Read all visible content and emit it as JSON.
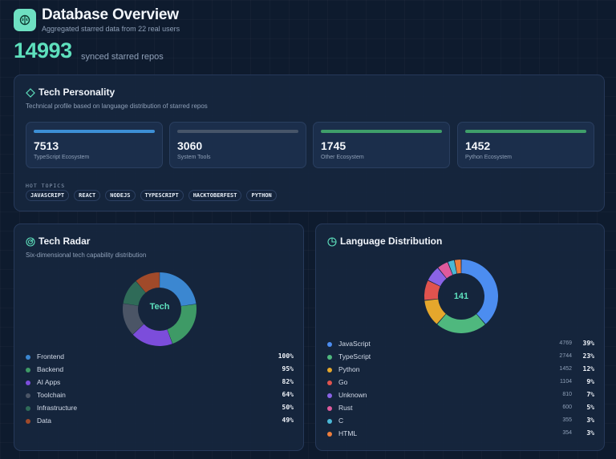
{
  "header": {
    "title": "Database Overview",
    "subtitle": "Aggregated starred data from 22 real users",
    "repo_count": "14993",
    "repo_caption": "synced starred repos"
  },
  "personality": {
    "title": "Tech Personality",
    "subtitle": "Technical profile based on language distribution of starred repos",
    "cards": [
      {
        "value": "7513",
        "label": "TypeScript Ecosystem",
        "color": "#3d8fd6"
      },
      {
        "value": "3060",
        "label": "System Tools",
        "color": "#475569"
      },
      {
        "value": "1745",
        "label": "Other Ecosystem",
        "color": "#3f9e6a"
      },
      {
        "value": "1452",
        "label": "Python Ecosystem",
        "color": "#3f9e6a"
      }
    ],
    "hot_topics_label": "HOT TOPICS",
    "topics": [
      "JAVASCRIPT",
      "REACT",
      "NODEJS",
      "TYPESCRIPT",
      "HACKTOBERFEST",
      "PYTHON"
    ]
  },
  "radar": {
    "title": "Tech Radar",
    "subtitle": "Six-dimensional tech capability distribution",
    "center_label": "Tech",
    "items": [
      {
        "name": "Frontend",
        "pct": "100%",
        "value": 100,
        "color": "#3b87d1"
      },
      {
        "name": "Backend",
        "pct": "95%",
        "value": 95,
        "color": "#3e9a66"
      },
      {
        "name": "AI Apps",
        "pct": "82%",
        "value": 82,
        "color": "#7c4ddb"
      },
      {
        "name": "Toolchain",
        "pct": "64%",
        "value": 64,
        "color": "#4b5566"
      },
      {
        "name": "Infrastructure",
        "pct": "50%",
        "value": 50,
        "color": "#2f6b58"
      },
      {
        "name": "Data",
        "pct": "49%",
        "value": 49,
        "color": "#a04a2a"
      }
    ]
  },
  "languages": {
    "title": "Language Distribution",
    "center_label": "141",
    "items": [
      {
        "name": "JavaScript",
        "count": "4769",
        "pct": "39%",
        "value": 39,
        "color": "#4c8df0"
      },
      {
        "name": "TypeScript",
        "count": "2744",
        "pct": "23%",
        "value": 23,
        "color": "#4fb87e"
      },
      {
        "name": "Python",
        "count": "1452",
        "pct": "12%",
        "value": 12,
        "color": "#e5a72c"
      },
      {
        "name": "Go",
        "count": "1104",
        "pct": "9%",
        "value": 9,
        "color": "#e0534e"
      },
      {
        "name": "Unknown",
        "count": "810",
        "pct": "7%",
        "value": 7,
        "color": "#8a63e6"
      },
      {
        "name": "Rust",
        "count": "600",
        "pct": "5%",
        "value": 5,
        "color": "#de5a9c"
      },
      {
        "name": "C",
        "count": "355",
        "pct": "3%",
        "value": 3,
        "color": "#4bb8d6"
      },
      {
        "name": "HTML",
        "count": "354",
        "pct": "3%",
        "value": 3,
        "color": "#ee7e3c"
      }
    ]
  }
}
